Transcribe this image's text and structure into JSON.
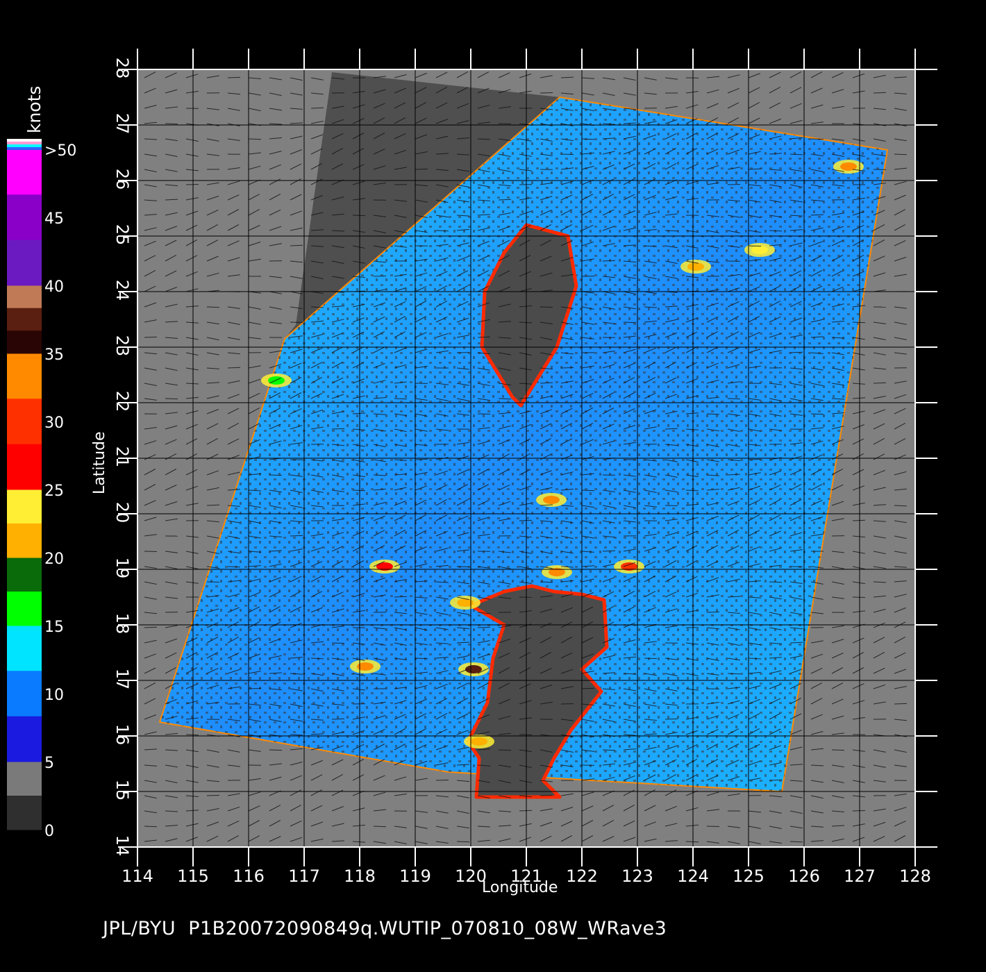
{
  "footer": {
    "source": "JPL/BYU",
    "filename": "P1B20072090849q.WUTIP_070810_08W_WRave3"
  },
  "axes": {
    "xlabel": "Longitude",
    "ylabel": "Latitude",
    "x_ticks": [
      "114",
      "115",
      "116",
      "117",
      "118",
      "119",
      "120",
      "121",
      "122",
      "123",
      "124",
      "125",
      "126",
      "127",
      "128"
    ],
    "y_ticks": [
      "14",
      "15",
      "16",
      "17",
      "18",
      "19",
      "20",
      "21",
      "22",
      "23",
      "24",
      "25",
      "26",
      "27",
      "28"
    ],
    "xlim": [
      114,
      128
    ],
    "ylim": [
      14,
      28
    ]
  },
  "colorbar": {
    "units": "knots",
    "labels": [
      "0",
      "5",
      "10",
      "15",
      "20",
      "25",
      "30",
      "35",
      "40",
      "45",
      ">50"
    ],
    "bands": [
      {
        "from": 0,
        "to": 5,
        "colors": [
          "#7a7a7a",
          "#2f2f2f"
        ]
      },
      {
        "from": 5,
        "to": 15,
        "colors": [
          "#00e4ff",
          "#0a7bff",
          "#1a1ae0"
        ]
      },
      {
        "from": 15,
        "to": 20,
        "colors": [
          "#0a6b0a",
          "#00ff00"
        ]
      },
      {
        "from": 20,
        "to": 25,
        "colors": [
          "#ffee33",
          "#ffb000"
        ]
      },
      {
        "from": 25,
        "to": 35,
        "colors": [
          "#ff8a00",
          "#ff3000",
          "#ff0000"
        ]
      },
      {
        "from": 35,
        "to": 40,
        "colors": [
          "#c07a55",
          "#5a1f10",
          "#2a0505"
        ]
      },
      {
        "from": 40,
        "to": 50,
        "colors": [
          "#ff00ff",
          "#8a00c8",
          "#6a1ac0"
        ]
      }
    ],
    "overflow_colors": [
      "#ffffff",
      "#ff9ad2",
      "#00ffff",
      "#3060ff"
    ]
  },
  "map": {
    "title": "",
    "colors": {
      "land": "#4b4b4b",
      "no_data": "#808080",
      "ocean_low": "#1a5cf0",
      "ocean_high": "#1ec8ff",
      "coast": "#ff2a00"
    },
    "swath_corners_lonlat": [
      [
        116.65,
        23.15
      ],
      [
        121.6,
        27.5
      ],
      [
        127.5,
        26.55
      ],
      [
        125.6,
        15.0
      ],
      [
        119.6,
        15.35
      ],
      [
        114.4,
        16.25
      ]
    ],
    "land_strip_lonlat": [
      [
        117.5,
        27.95
      ],
      [
        121.6,
        27.5
      ],
      [
        116.65,
        23.15
      ],
      [
        116.85,
        23.4
      ]
    ],
    "landmasses": [
      {
        "name": "",
        "outline_lonlat": [
          [
            121.0,
            25.2
          ],
          [
            121.75,
            25.0
          ],
          [
            121.9,
            24.1
          ],
          [
            121.55,
            23.0
          ],
          [
            120.9,
            21.95
          ],
          [
            120.75,
            22.1
          ],
          [
            120.2,
            23.0
          ],
          [
            120.25,
            24.0
          ],
          [
            120.6,
            24.7
          ]
        ]
      },
      {
        "name": "",
        "outline_lonlat": [
          [
            120.0,
            18.35
          ],
          [
            120.6,
            18.6
          ],
          [
            121.1,
            18.7
          ],
          [
            121.5,
            18.6
          ],
          [
            122.0,
            18.55
          ],
          [
            122.4,
            18.45
          ],
          [
            122.45,
            17.6
          ],
          [
            122.0,
            17.2
          ],
          [
            122.35,
            16.8
          ],
          [
            121.8,
            16.1
          ],
          [
            121.5,
            15.6
          ],
          [
            121.3,
            15.2
          ],
          [
            121.6,
            14.9
          ],
          [
            120.1,
            14.9
          ],
          [
            120.15,
            15.6
          ],
          [
            119.95,
            15.9
          ],
          [
            120.3,
            16.6
          ],
          [
            120.4,
            17.4
          ],
          [
            120.6,
            18.0
          ]
        ]
      }
    ],
    "high_wind_patches_lonlat": [
      {
        "lon": 118.45,
        "lat": 19.05,
        "knots": 32
      },
      {
        "lon": 120.05,
        "lat": 17.2,
        "knots": 38
      },
      {
        "lon": 121.55,
        "lat": 18.95,
        "knots": 28
      },
      {
        "lon": 122.85,
        "lat": 19.05,
        "knots": 30
      },
      {
        "lon": 124.05,
        "lat": 24.45,
        "knots": 24
      },
      {
        "lon": 126.8,
        "lat": 26.25,
        "knots": 26
      },
      {
        "lon": 118.1,
        "lat": 17.25,
        "knots": 27
      },
      {
        "lon": 120.15,
        "lat": 15.9,
        "knots": 24
      },
      {
        "lon": 119.9,
        "lat": 18.4,
        "knots": 23
      },
      {
        "lon": 121.45,
        "lat": 20.25,
        "knots": 25
      },
      {
        "lon": 125.2,
        "lat": 24.75,
        "knots": 22
      },
      {
        "lon": 116.5,
        "lat": 22.4,
        "knots": 18
      }
    ]
  }
}
